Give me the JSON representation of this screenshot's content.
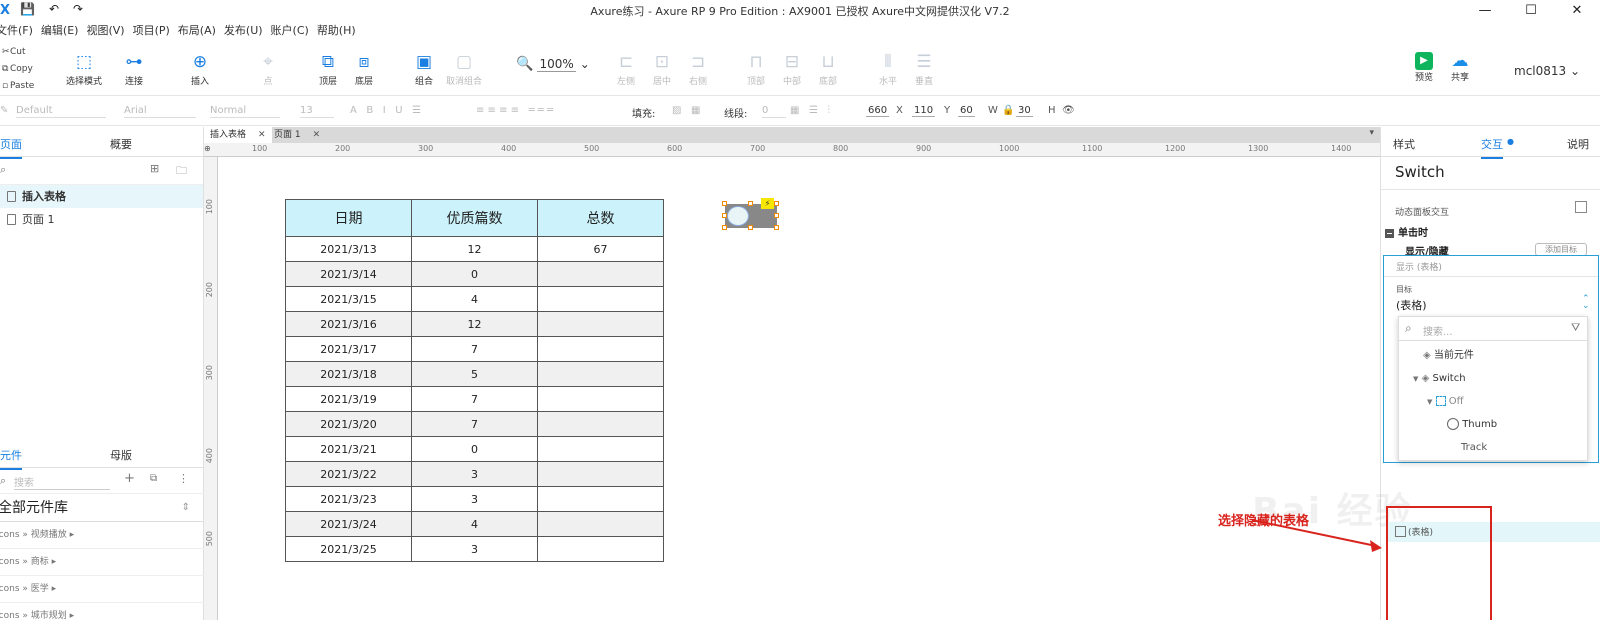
{
  "window": {
    "title": "Axure练习 - Axure RP 9 Pro Edition : AX9001 已授权    Axure中文网提供汉化 V7.2",
    "logo": "X",
    "quick_icons": [
      "save-icon",
      "undo-icon",
      "redo-icon"
    ],
    "controls": [
      "—",
      "☐",
      "✕"
    ]
  },
  "menu": [
    "文件(F)",
    "编辑(E)",
    "视图(V)",
    "项目(P)",
    "布局(A)",
    "发布(U)",
    "账户(C)",
    "帮助(H)"
  ],
  "toolbar": {
    "clipboard": [
      "Cut",
      "Copy",
      "Paste"
    ],
    "tools": [
      {
        "label": "选择模式",
        "icon": "⬚",
        "dim": false
      },
      {
        "label": "连接",
        "icon": "⊶",
        "dim": false
      },
      {
        "label": "插入",
        "icon": "⊕",
        "dim": false
      },
      {
        "label": "点",
        "icon": "⌖",
        "dim": true
      },
      {
        "label": "顶层",
        "icon": "⧉",
        "dim": false
      },
      {
        "label": "底层",
        "icon": "⧈",
        "dim": false
      },
      {
        "label": "组合",
        "icon": "▣",
        "dim": false
      },
      {
        "label": "取消组合",
        "icon": "▢",
        "dim": true
      },
      {
        "label": "左侧",
        "icon": "⊏",
        "dim": true
      },
      {
        "label": "居中",
        "icon": "⊡",
        "dim": true
      },
      {
        "label": "右侧",
        "icon": "⊐",
        "dim": true
      },
      {
        "label": "顶部",
        "icon": "⊓",
        "dim": true
      },
      {
        "label": "中部",
        "icon": "⊟",
        "dim": true
      },
      {
        "label": "底部",
        "icon": "⊔",
        "dim": true
      },
      {
        "label": "水平",
        "icon": "⫴",
        "dim": true
      },
      {
        "label": "垂直",
        "icon": "☰",
        "dim": true
      }
    ],
    "zoom": "100%",
    "preview_label": "预览",
    "share_label": "共享",
    "user": "mcl0813"
  },
  "format": {
    "style": "Default",
    "font": "Arial",
    "weight": "Normal",
    "size": "13",
    "fill_label": "填充:",
    "line_label": "线段:",
    "line_value": "0",
    "x": "660",
    "x_label": "X",
    "y": "110",
    "y_label": "Y",
    "w": "60",
    "w_label": "W",
    "h": "30",
    "h_label": "H"
  },
  "left_panel": {
    "tabs": [
      "页面",
      "概要"
    ],
    "pages": [
      "插入表格",
      "页面 1"
    ],
    "lib_tabs": [
      "元件",
      "母版"
    ],
    "lib_search_placeholder": "搜索",
    "library": "全部元件库",
    "lib_items": [
      "Icons » 视频播放 ▸",
      "Icons » 商标 ▸",
      "Icons » 医学 ▸",
      "Icons » 城市规划 ▸"
    ]
  },
  "doc_tabs": [
    "插入表格",
    "页面 1"
  ],
  "ruler": {
    "h": [
      "100",
      "200",
      "300",
      "400",
      "500",
      "600",
      "700",
      "800",
      "900",
      "1000",
      "1100",
      "1200",
      "1300",
      "1400"
    ],
    "v": [
      "100",
      "200",
      "300",
      "400",
      "500"
    ]
  },
  "table": {
    "headers": [
      "日期",
      "优质篇数",
      "总数"
    ],
    "rows": [
      [
        "2021/3/13",
        "12",
        "67"
      ],
      [
        "2021/3/14",
        "0",
        ""
      ],
      [
        "2021/3/15",
        "4",
        ""
      ],
      [
        "2021/3/16",
        "12",
        ""
      ],
      [
        "2021/3/17",
        "7",
        ""
      ],
      [
        "2021/3/18",
        "5",
        ""
      ],
      [
        "2021/3/19",
        "7",
        ""
      ],
      [
        "2021/3/20",
        "7",
        ""
      ],
      [
        "2021/3/21",
        "0",
        ""
      ],
      [
        "2021/3/22",
        "3",
        ""
      ],
      [
        "2021/3/23",
        "3",
        ""
      ],
      [
        "2021/3/24",
        "4",
        ""
      ],
      [
        "2021/3/25",
        "3",
        ""
      ]
    ]
  },
  "right_panel": {
    "tabs": [
      "样式",
      "交互",
      "说明"
    ],
    "active_tab": "交互",
    "widget_name": "Switch",
    "sub_label": "动态面板交互",
    "event": "单击时",
    "action": "显示/隐藏",
    "add_target": "添加目标",
    "show_hint": "显示 (表格)",
    "target_label": "目标",
    "target_value": "(表格)",
    "search_placeholder": "搜索...",
    "tree": [
      "当前元件",
      "Switch",
      "Off",
      "Thumb",
      "Track"
    ]
  },
  "overlay": {
    "annotation": "选择隐藏的表格",
    "mini_label": "(表格)"
  }
}
